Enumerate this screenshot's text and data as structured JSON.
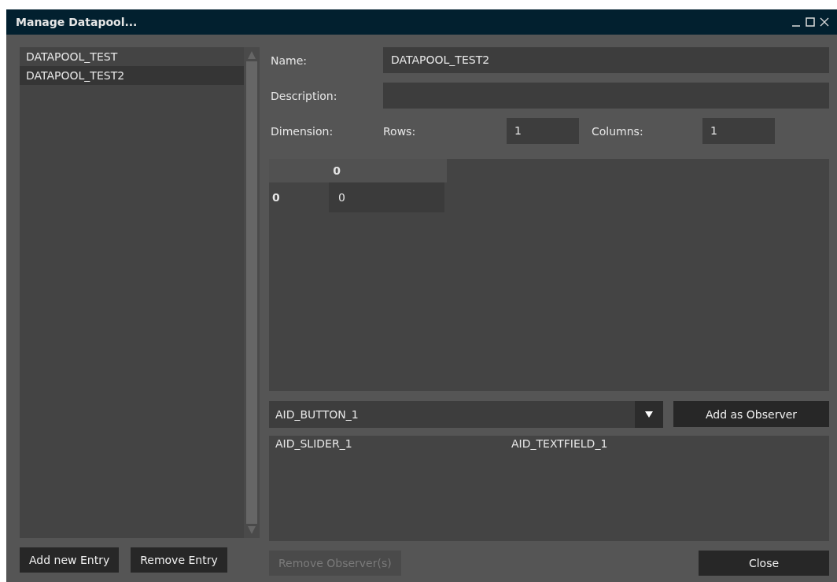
{
  "window": {
    "title": "Manage Datapool..."
  },
  "entries": [
    {
      "label": "DATAPOOL_TEST",
      "selected": false
    },
    {
      "label": "DATAPOOL_TEST2",
      "selected": true
    }
  ],
  "form": {
    "name_label": "Name:",
    "name_value": "DATAPOOL_TEST2",
    "description_label": "Description:",
    "dimension_label": "Dimension:",
    "rows_label": "Rows:",
    "rows_value": "1",
    "columns_label": "Columns:",
    "columns_value": "1"
  },
  "table": {
    "columns": [
      "0"
    ],
    "rows": [
      {
        "header": "0",
        "cells": [
          "0"
        ]
      }
    ]
  },
  "observer_select": {
    "value": "AID_BUTTON_1"
  },
  "observers": [
    "AID_SLIDER_1",
    "AID_TEXTFIELD_1"
  ],
  "buttons": [
    {
      "label": "Add new Entry",
      "disabled": false
    },
    {
      "label": "Remove Entry",
      "disabled": false
    },
    {
      "label": "Remove Observer(s)",
      "disabled": true
    }
  ],
  "add_observer_button": "Add as Observer",
  "close_button": "Close"
}
